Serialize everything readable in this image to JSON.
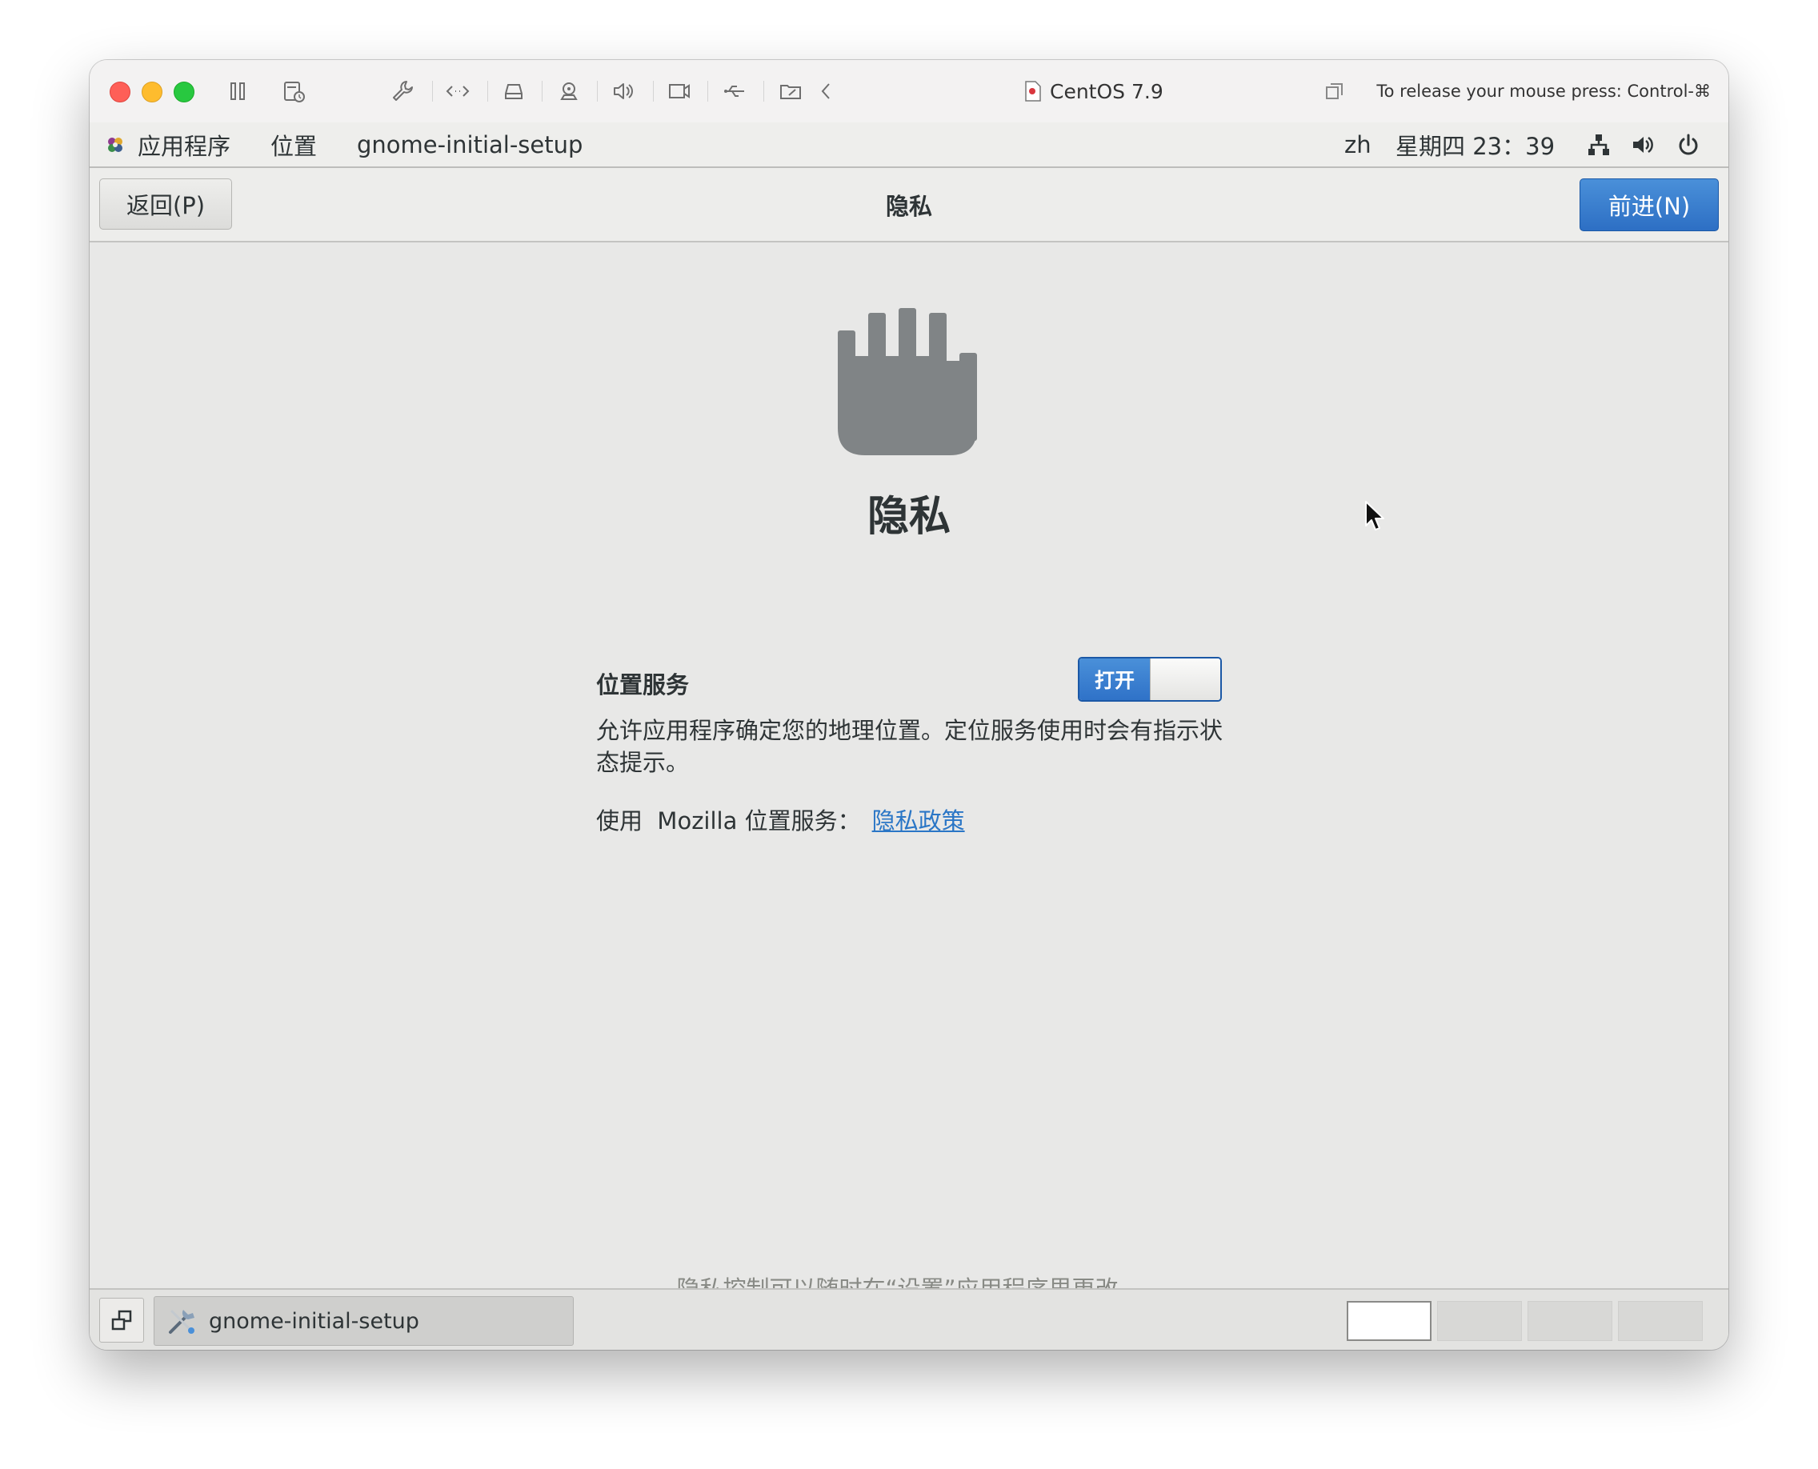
{
  "vm_toolbar": {
    "title": "CentOS 7.9",
    "release_hint": "To release your mouse press: Control-⌘",
    "icons": [
      "pause-icon",
      "snapshot-icon",
      "wrench-icon",
      "code-icon",
      "disk-icon",
      "camera-icon",
      "speaker-icon",
      "video-icon",
      "usb-icon",
      "shared-folder-icon",
      "chevron-left-icon",
      "copy-window-icon"
    ]
  },
  "gnome_bar": {
    "applications": "应用程序",
    "places": "位置",
    "active_app": "gnome-initial-setup",
    "language": "zh",
    "clock": "星期四 23：39"
  },
  "header": {
    "back_label": "返回(P)",
    "title": "隐私",
    "next_label": "前进(N)",
    "next_color": "#3a80d2"
  },
  "privacy": {
    "heading": "隐私",
    "location_label": "位置服务",
    "toggle_label": "打开",
    "toggle_state": "on",
    "description": "允许应用程序确定您的地理位置。定位服务使用时会有指示状态提示。",
    "mozilla_text": "使用  Mozilla 位置服务：",
    "policy_link": "隐私政策",
    "footer": "隐私控制可以随时在“设置”应用程序里更改。"
  },
  "taskbar": {
    "window_label": "gnome-initial-setup",
    "workspaces": 4,
    "active_workspace": 1
  }
}
